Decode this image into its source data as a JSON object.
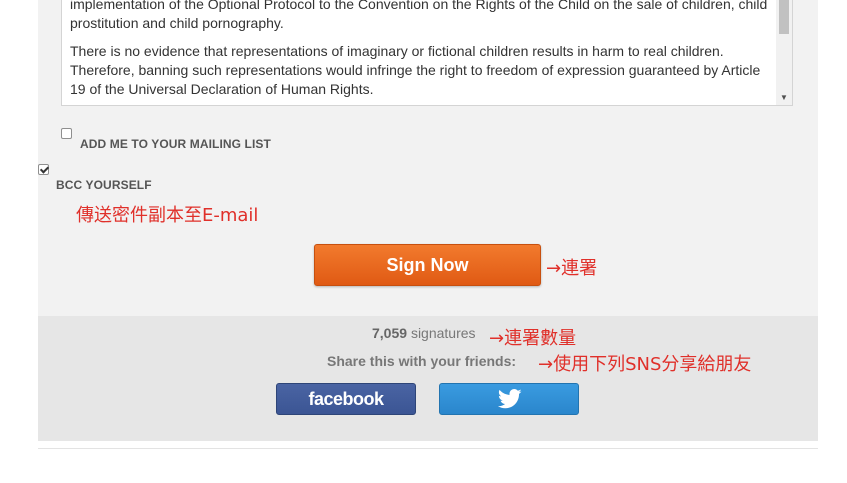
{
  "letter": {
    "paragraph1": "implementation of the Optional Protocol to the Convention on the Rights of the Child on the sale of children, child prostitution and child pornography.",
    "paragraph2": "There is no evidence that representations of imaginary or fictional children results in harm to real children. Therefore, banning such representations would infringe the right to freedom of expression guaranteed by Article 19 of the Universal Declaration of Human Rights."
  },
  "options": {
    "mailing_list_label": "ADD ME TO YOUR MAILING LIST",
    "mailing_list_checked": false,
    "bcc_label": "BCC YOURSELF",
    "bcc_checked": true
  },
  "annotations": {
    "bcc_note": "傳送密件副本至E-mail",
    "sign_note": "→連署",
    "count_note": "→連署數量",
    "share_note": "→使用下列SNS分享給朋友"
  },
  "sign_button": {
    "label": "Sign Now"
  },
  "signatures": {
    "count": "7,059",
    "suffix": "signatures"
  },
  "share": {
    "label": "Share this with your friends:",
    "facebook_label": "facebook",
    "twitter_icon": "twitter-bird-icon"
  },
  "colors": {
    "sign_button": "#e8661c",
    "facebook": "#3b5594",
    "twitter": "#2a8ed6",
    "annotation": "#e0302a"
  }
}
